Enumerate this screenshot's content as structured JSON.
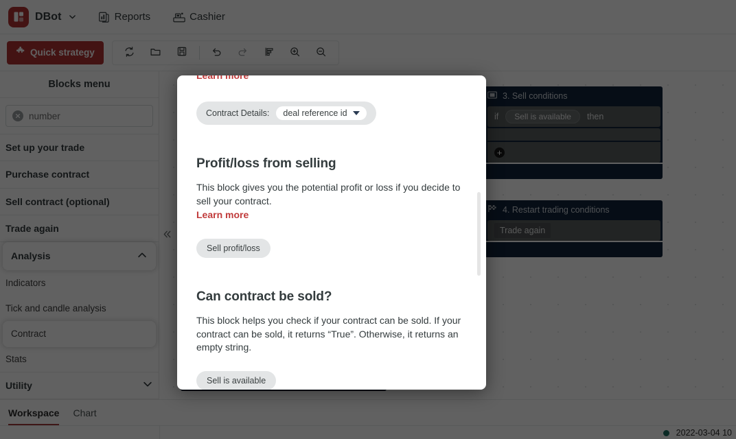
{
  "header": {
    "brand_name": "DBot",
    "brand_logo_icon": "dbot-logo-icon",
    "brand_caret_icon": "chevron-down-icon",
    "nav": [
      {
        "label": "Reports",
        "icon": "reports-icon"
      },
      {
        "label": "Cashier",
        "icon": "cashier-icon"
      }
    ]
  },
  "toolbar": {
    "quick_strategy_label": "Quick strategy",
    "quick_strategy_icon": "puzzle-icon",
    "quick_strategy_color": "#b03434",
    "buttons": [
      {
        "name": "reset-button",
        "icon": "refresh-icon"
      },
      {
        "name": "open-button",
        "icon": "folder-open-icon"
      },
      {
        "name": "save-button",
        "icon": "save-icon"
      },
      {
        "name": "undo-button",
        "icon": "undo-icon"
      },
      {
        "name": "redo-button",
        "icon": "redo-icon"
      },
      {
        "name": "sort-button",
        "icon": "sort-blocks-icon"
      },
      {
        "name": "zoom-in-button",
        "icon": "zoom-in-icon"
      },
      {
        "name": "zoom-out-button",
        "icon": "zoom-out-icon"
      }
    ]
  },
  "sidebar": {
    "title": "Blocks menu",
    "search": {
      "value": "number",
      "clear_icon": "clear-icon"
    },
    "categories": [
      {
        "label": "Set up your trade",
        "expanded": false
      },
      {
        "label": "Purchase contract",
        "expanded": false
      },
      {
        "label": "Sell contract (optional)",
        "expanded": false
      },
      {
        "label": "Trade again",
        "expanded": false
      },
      {
        "label": "Analysis",
        "expanded": true,
        "chevron_icon": "chevron-up-icon"
      }
    ],
    "analysis_children": [
      {
        "label": "Indicators",
        "selected": false
      },
      {
        "label": "Tick and candle analysis",
        "selected": false
      },
      {
        "label": "Contract",
        "selected": true
      },
      {
        "label": "Stats",
        "selected": false
      }
    ],
    "utility": {
      "label": "Utility",
      "chevron_icon": "chevron-down-icon"
    },
    "collapse_icon": "double-chevron-left-icon"
  },
  "workspace": {
    "blocks": [
      {
        "title": "3. Sell conditions",
        "icon": "sell-conditions-icon",
        "if_label": "if",
        "condition_label": "Sell is available",
        "then_label": "then",
        "plus_icon": "plus-icon"
      },
      {
        "title": "4. Restart trading conditions",
        "icon": "restart-flag-icon",
        "statement_label": "Trade again"
      }
    ]
  },
  "modal": {
    "top_learn_more": "Learn more",
    "block_preview": {
      "label": "Contract Details:",
      "selected_option": "deal reference id",
      "caret_icon": "caret-down-icon"
    },
    "sections": [
      {
        "heading": "Profit/loss from selling",
        "body": "This block gives you the potential profit or loss if you decide to sell your contract.",
        "learn_more": "Learn more",
        "chip": "Sell profit/loss"
      },
      {
        "heading": "Can contract be sold?",
        "body": "This block helps you check if your contract can be sold. If your contract can be sold, it returns “True”. Otherwise, it returns an empty string.",
        "chip": "Sell is available"
      }
    ]
  },
  "bottom": {
    "tabs": [
      {
        "label": "Workspace",
        "active": true
      },
      {
        "label": "Chart",
        "active": false
      }
    ],
    "status_dot_color": "#1d6f62",
    "timestamp": "2022-03-04 10"
  }
}
